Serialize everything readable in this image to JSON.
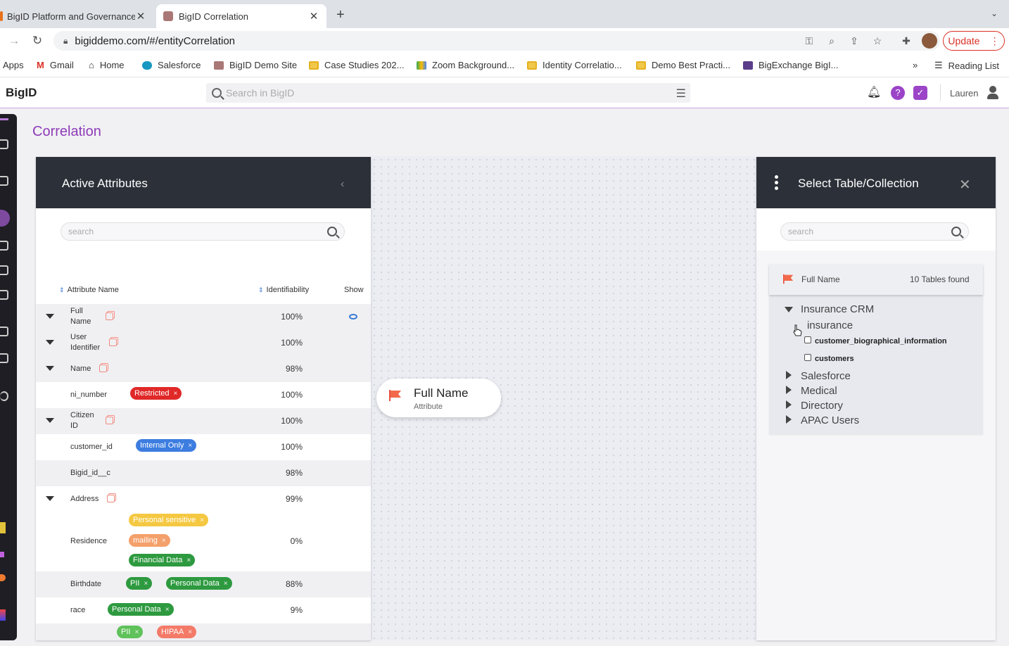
{
  "browser": {
    "tabs": [
      {
        "title": "BigID Platform and Governance",
        "active": false
      },
      {
        "title": "BigID Correlation",
        "active": true
      }
    ],
    "url": "bigiddemo.com/#/entityCorrelation",
    "update_label": "Update",
    "bookmarks": [
      "Apps",
      "Gmail",
      "Home",
      "Salesforce",
      "BigID Demo Site",
      "Case Studies 202...",
      "Zoom Background...",
      "Identity Correlatio...",
      "Demo Best Practi...",
      "BigExchange BigI..."
    ],
    "more_bookmarks": "»",
    "reading_list": "Reading List"
  },
  "app": {
    "logo": "BigID",
    "search_placeholder": "Search in BigID",
    "user": "Lauren",
    "help_glyph": "?",
    "check_glyph": "✓",
    "page_title": "Correlation"
  },
  "active_attributes": {
    "title": "Active Attributes",
    "search_placeholder": "search",
    "columns": {
      "name": "Attribute Name",
      "identifiability": "Identifiability",
      "show": "Show"
    },
    "rows": [
      {
        "name": "Full Name",
        "pct": "100%"
      },
      {
        "name": "User Identifier",
        "pct": "100%"
      },
      {
        "name": "Name",
        "pct": "98%"
      },
      {
        "name": "ni_number",
        "pct": "100%",
        "tags": [
          "Restricted"
        ]
      },
      {
        "name": "Citizen ID",
        "pct": "100%"
      },
      {
        "name": "customer_id",
        "pct": "100%",
        "tags": [
          "Internal Only"
        ]
      },
      {
        "name": "Bigid_id__c",
        "pct": "98%"
      },
      {
        "name": "Address",
        "pct": "99%"
      },
      {
        "name": "Residence",
        "pct": "0%",
        "tags": [
          "Personal sensitive",
          "mailing",
          "Financial Data"
        ]
      },
      {
        "name": "Birthdate",
        "pct": "88%",
        "tags": [
          "PII",
          "Personal Data"
        ]
      },
      {
        "name": "race",
        "pct": "9%",
        "tags": [
          "Personal Data"
        ]
      },
      {
        "name": "",
        "pct": "",
        "tags": [
          "PII",
          "HIPAA"
        ]
      }
    ]
  },
  "node": {
    "title": "Full Name",
    "subtitle": "Attribute"
  },
  "select_table": {
    "title": "Select Table/Collection",
    "search_placeholder": "search",
    "attribute": "Full Name",
    "found": "10 Tables found",
    "tree": [
      {
        "label": "Insurance CRM",
        "expanded": true,
        "children": [
          {
            "label": "insurance",
            "children": [
              "customer_biographical_information",
              "customers"
            ]
          }
        ]
      },
      {
        "label": "Salesforce",
        "expanded": false
      },
      {
        "label": "Medical",
        "expanded": false
      },
      {
        "label": "Directory",
        "expanded": false
      },
      {
        "label": "APAC Users",
        "expanded": false
      }
    ]
  },
  "tag_remove_glyph": "×",
  "colors": {
    "accent": "#8e3bb8",
    "panel_header": "#2c3038",
    "restricted": "#e02828",
    "internal": "#3d7de0",
    "green": "#2e9a40"
  }
}
